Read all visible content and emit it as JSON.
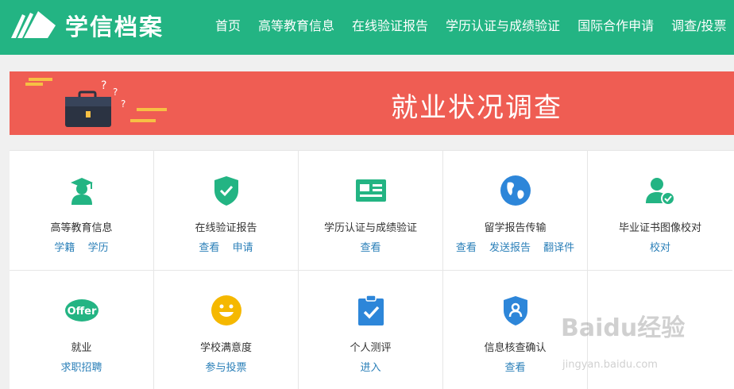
{
  "header": {
    "logo_text": "学信档案",
    "nav": [
      "首页",
      "高等教育信息",
      "在线验证报告",
      "学历认证与成绩验证",
      "国际合作申请",
      "调查/投票"
    ]
  },
  "banner": {
    "title": "就业状况调查"
  },
  "grid": {
    "cells": [
      {
        "title": "高等教育信息",
        "links": [
          "学籍",
          "学历"
        ],
        "icon": "graduate-icon"
      },
      {
        "title": "在线验证报告",
        "links": [
          "查看",
          "申请"
        ],
        "icon": "shield-check-icon"
      },
      {
        "title": "学历认证与成绩验证",
        "links": [
          "查看"
        ],
        "icon": "id-card-icon"
      },
      {
        "title": "留学报告传输",
        "links": [
          "查看",
          "发送报告",
          "翻译件"
        ],
        "icon": "globe-icon"
      },
      {
        "title": "毕业证书图像校对",
        "links": [
          "校对"
        ],
        "icon": "user-check-icon"
      },
      {
        "title": "就业",
        "links": [
          "求职招聘"
        ],
        "icon": "offer-badge-icon",
        "icon_text": "Offer"
      },
      {
        "title": "学校满意度",
        "links": [
          "参与投票"
        ],
        "icon": "smiley-icon"
      },
      {
        "title": "个人测评",
        "links": [
          "进入"
        ],
        "icon": "clipboard-check-icon"
      },
      {
        "title": "信息核查确认",
        "links": [
          "查看"
        ],
        "icon": "user-shield-icon"
      }
    ]
  },
  "watermark": {
    "brand": "Baidu经验",
    "url": "jingyan.baidu.com"
  },
  "colors": {
    "primary": "#23b483",
    "banner": "#ef5d53",
    "link": "#2a7fb8",
    "icon_blue": "#2d86d9",
    "icon_yellow": "#f5b800"
  }
}
